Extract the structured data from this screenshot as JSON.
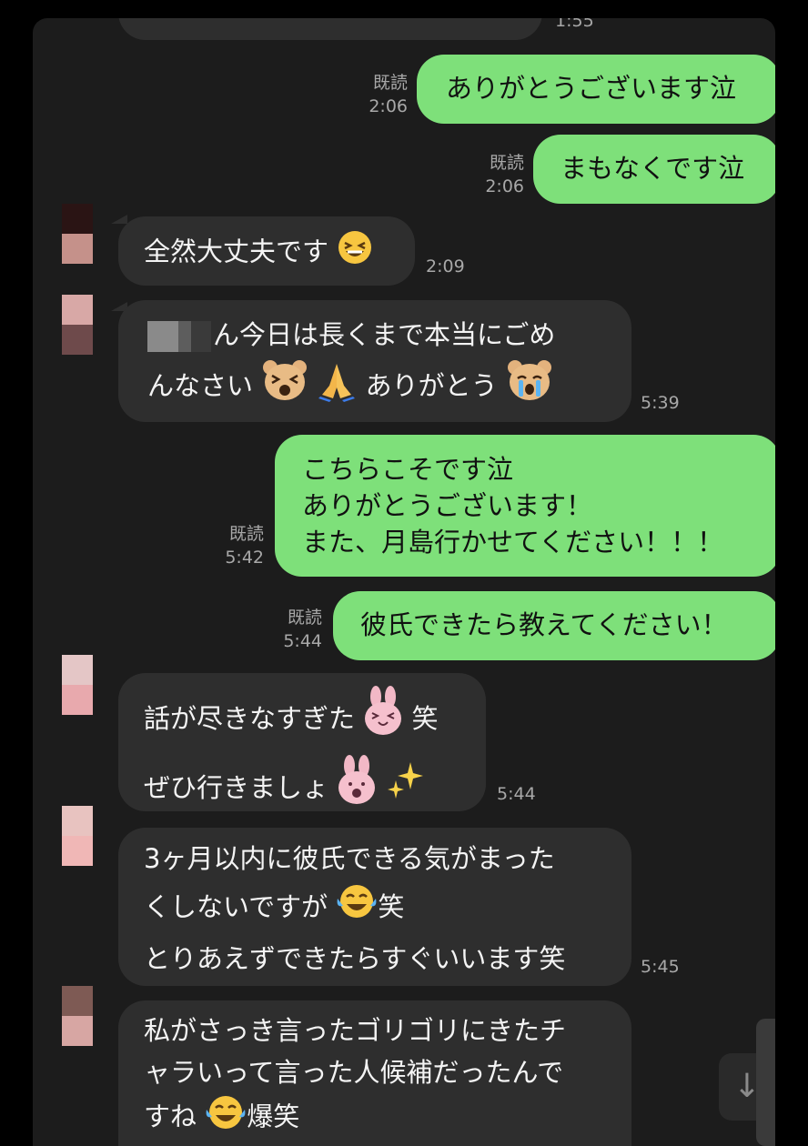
{
  "chat": {
    "top_time": "1:55",
    "messages": [
      {
        "dir": "out",
        "read": "既読",
        "time": "2:06",
        "lines": [
          "ありがとうございます泣"
        ]
      },
      {
        "dir": "out",
        "read": "既読",
        "time": "2:06",
        "lines": [
          "まもなくです泣"
        ]
      },
      {
        "dir": "in",
        "time": "2:09",
        "lines": [
          "全然大丈夫です"
        ]
      },
      {
        "dir": "in",
        "time": "5:39",
        "lines": [
          "ん今日は長くまで本当にごめ",
          "んなさい",
          "ありがとう"
        ]
      },
      {
        "dir": "out",
        "read": "既読",
        "time": "5:42",
        "lines": [
          "こちらこそです泣",
          "ありがとうございます！",
          "また、月島行かせてください！！！"
        ]
      },
      {
        "dir": "out",
        "read": "既読",
        "time": "5:44",
        "lines": [
          "彼氏できたら教えてください！"
        ]
      },
      {
        "dir": "in",
        "time": "5:44",
        "lines": [
          "話が尽きなすぎた",
          "笑",
          "ぜひ行きましょ"
        ]
      },
      {
        "dir": "in",
        "time": "5:45",
        "lines": [
          "3ヶ月以内に彼氏できる気がまった",
          "くしないですが",
          "笑",
          "とりあえずできたらすぐいいます笑"
        ]
      },
      {
        "dir": "in",
        "lines": [
          "私がさっき言ったゴリゴリにきたチ",
          "ャラいって言った人候補だったんで",
          "すね",
          "爆笑"
        ]
      }
    ]
  },
  "icons": [
    "grin-squint-emoji",
    "bear-crying-emoji",
    "folded-hands-emoji",
    "bear-sob-emoji",
    "bunny-laugh-emoji",
    "bunny-shout-emoji",
    "sparkles-emoji",
    "tears-of-joy-emoji",
    "scroll-down-arrow-icon"
  ],
  "colors": {
    "background": "#1c1c1c",
    "incoming": "#2e2e2e",
    "outgoing": "#7ee07a",
    "meta": "#a8a8a8"
  }
}
